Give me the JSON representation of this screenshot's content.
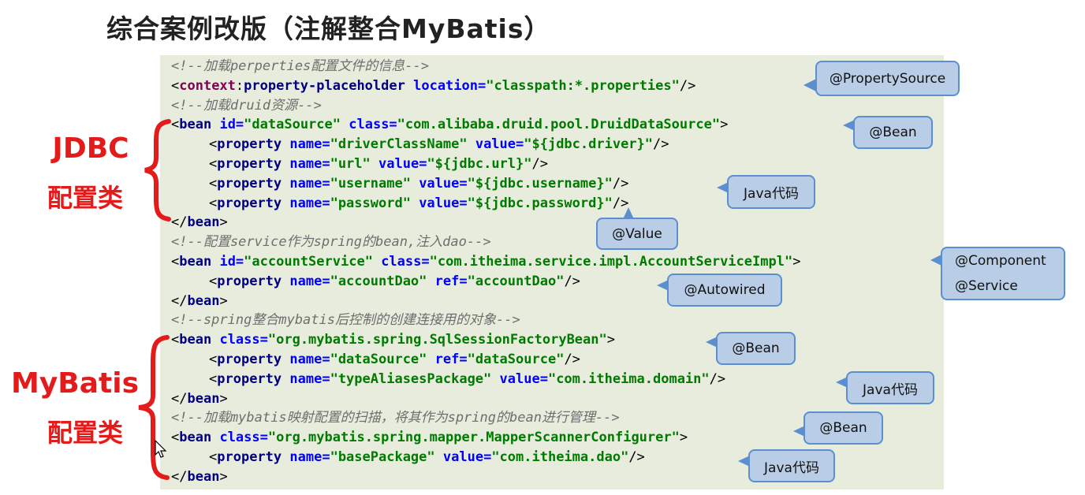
{
  "title": "综合案例改版（注解整合MyBatis）",
  "code": {
    "c1": "<!--加载perperties配置文件的信息-->",
    "l2": {
      "lt": "<",
      "ns": "context",
      "colon": ":",
      "tag": "property-placeholder",
      "attr1": "location=",
      "val1": "\"classpath:*.properties\"",
      "end": "/>"
    },
    "c3": "<!--加载druid资源-->",
    "l4": {
      "lt": "<",
      "tag": "bean",
      "attr1": "id=",
      "val1": "\"dataSource\"",
      "attr2": "class=",
      "val2": "\"com.alibaba.druid.pool.DruidDataSource\"",
      "end": ">"
    },
    "l5": {
      "lt": "<",
      "tag": "property",
      "attr1": "name=",
      "val1": "\"driverClassName\"",
      "attr2": "value=",
      "val2": "\"${jdbc.driver}\"",
      "end": "/>"
    },
    "l6": {
      "lt": "<",
      "tag": "property",
      "attr1": "name=",
      "val1": "\"url\"",
      "attr2": "value=",
      "val2": "\"${jdbc.url}\"",
      "end": "/>"
    },
    "l7": {
      "lt": "<",
      "tag": "property",
      "attr1": "name=",
      "val1": "\"username\"",
      "attr2": "value=",
      "val2": "\"${jdbc.username}\"",
      "end": "/>"
    },
    "l8": {
      "lt": "<",
      "tag": "property",
      "attr1": "name=",
      "val1": "\"password\"",
      "attr2": "value=",
      "val2": "\"${jdbc.password}\"",
      "end": "/>"
    },
    "l9": {
      "lt": "</",
      "tag": "bean",
      "end": ">"
    },
    "c10": "<!--配置service作为spring的bean,注入dao-->",
    "l11": {
      "lt": "<",
      "tag": "bean",
      "attr1": "id=",
      "val1": "\"accountService\"",
      "attr2": "class=",
      "val2": "\"com.itheima.service.impl.AccountServiceImpl\"",
      "end": ">"
    },
    "l12": {
      "lt": "<",
      "tag": "property",
      "attr1": "name=",
      "val1": "\"accountDao\"",
      "attr2": "ref=",
      "val2": "\"accountDao\"",
      "end": "/>"
    },
    "l13": {
      "lt": "</",
      "tag": "bean",
      "end": ">"
    },
    "c14": "<!--spring整合mybatis后控制的创建连接用的对象-->",
    "l15": {
      "lt": "<",
      "tag": "bean",
      "attr1": "class=",
      "val1": "\"org.mybatis.spring.SqlSessionFactoryBean\"",
      "end": ">"
    },
    "l16": {
      "lt": "<",
      "tag": "property",
      "attr1": "name=",
      "val1": "\"dataSource\"",
      "attr2": "ref=",
      "val2": "\"dataSource\"",
      "end": "/>"
    },
    "l17": {
      "lt": "<",
      "tag": "property",
      "attr1": "name=",
      "val1": "\"typeAliasesPackage\"",
      "attr2": "value=",
      "val2": "\"com.itheima.domain\"",
      "end": "/>"
    },
    "l18": {
      "lt": "</",
      "tag": "bean",
      "end": ">"
    },
    "c19": "<!--加载mybatis映射配置的扫描，将其作为spring的bean进行管理-->",
    "l20": {
      "lt": "<",
      "tag": "bean",
      "attr1": "class=",
      "val1": "\"org.mybatis.spring.mapper.MapperScannerConfigurer\"",
      "end": ">"
    },
    "l21": {
      "lt": "<",
      "tag": "property",
      "attr1": "name=",
      "val1": "\"basePackage\"",
      "attr2": "value=",
      "val2": "\"com.itheima.dao\"",
      "end": "/>"
    },
    "l22": {
      "lt": "</",
      "tag": "bean",
      "end": ">"
    }
  },
  "callouts": {
    "property_source": "@PropertySource",
    "bean1": "@Bean",
    "java_code1": "Java代码",
    "value": "@Value",
    "component": "@Component",
    "service": "@Service",
    "autowired": "@Autowired",
    "bean2": "@Bean",
    "java_code2": "Java代码",
    "bean3": "@Bean",
    "java_code3": "Java代码"
  },
  "side_labels": {
    "jdbc_line1": "JDBC",
    "jdbc_line2": "配置类",
    "mybatis_line1": "MyBatis",
    "mybatis_line2": "配置类"
  },
  "colors": {
    "callout_fill": "#b9cde6",
    "callout_border": "#5b8fcf",
    "label_red": "#e31b1b",
    "code_bg": "#e7ecdd"
  }
}
